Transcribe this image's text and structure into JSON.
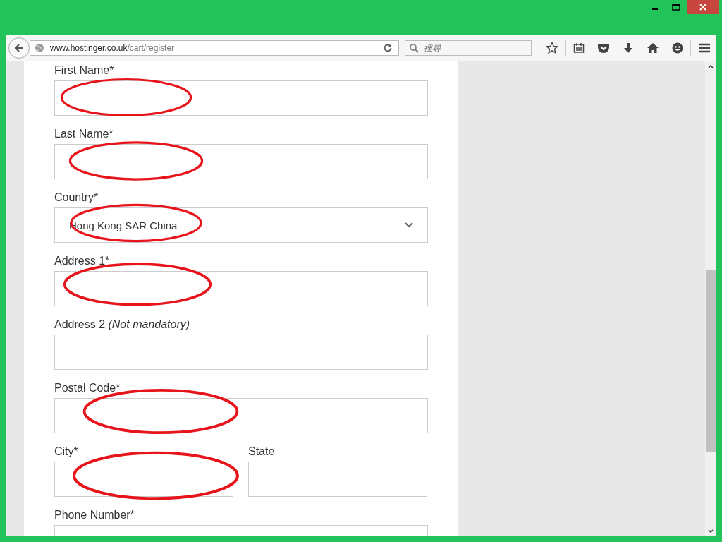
{
  "browser": {
    "url_host": "www.hostinger.co.uk",
    "url_path": "/cart/register",
    "search": {
      "placeholder": "搜尋"
    }
  },
  "form": {
    "fields": [
      {
        "kind": "text",
        "label": "First Name*",
        "annotated": true
      },
      {
        "kind": "text",
        "label": "Last Name*",
        "annotated": true
      },
      {
        "kind": "select",
        "label": "Country*",
        "value": "Hong Kong SAR China",
        "annotated": true
      },
      {
        "kind": "text",
        "label": "Address 1*",
        "annotated": true
      },
      {
        "kind": "text",
        "label": "Address 2 *(Not mandatory)*",
        "annotated": false
      },
      {
        "kind": "text",
        "label": "Postal Code*",
        "annotated": true
      },
      {
        "kind": "pair",
        "items": [
          {
            "label": "City*",
            "annotated": true
          },
          {
            "label": "State",
            "annotated": false
          }
        ]
      },
      {
        "kind": "phone",
        "label": "Phone Number*"
      }
    ]
  }
}
